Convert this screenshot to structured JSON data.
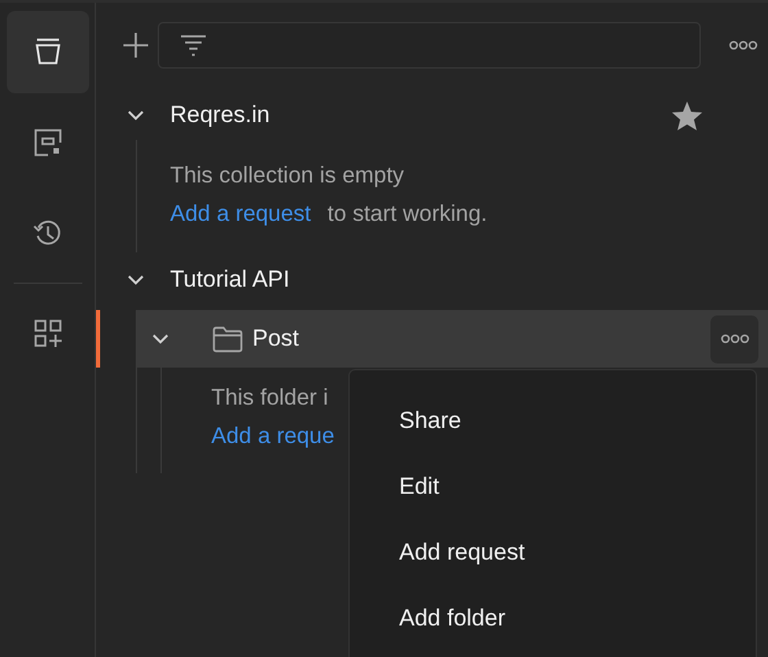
{
  "rail": [
    {
      "selected": true
    },
    {
      "selected": false
    },
    {
      "selected": false
    },
    {
      "selected": false
    }
  ],
  "collections": [
    {
      "name": "Reqres.in",
      "expanded": true,
      "starred": true,
      "empty_text": "This collection is empty",
      "link": "Add a request",
      "after_link": "to start working."
    },
    {
      "name": "Tutorial API",
      "expanded": true,
      "starred": false,
      "children": [
        {
          "name": "Post",
          "expanded": true,
          "selected": true,
          "empty_text": "This folder i",
          "link": "Add a reque"
        }
      ]
    }
  ],
  "context_menu": [
    "Share",
    "Edit",
    "Add request",
    "Add folder"
  ]
}
